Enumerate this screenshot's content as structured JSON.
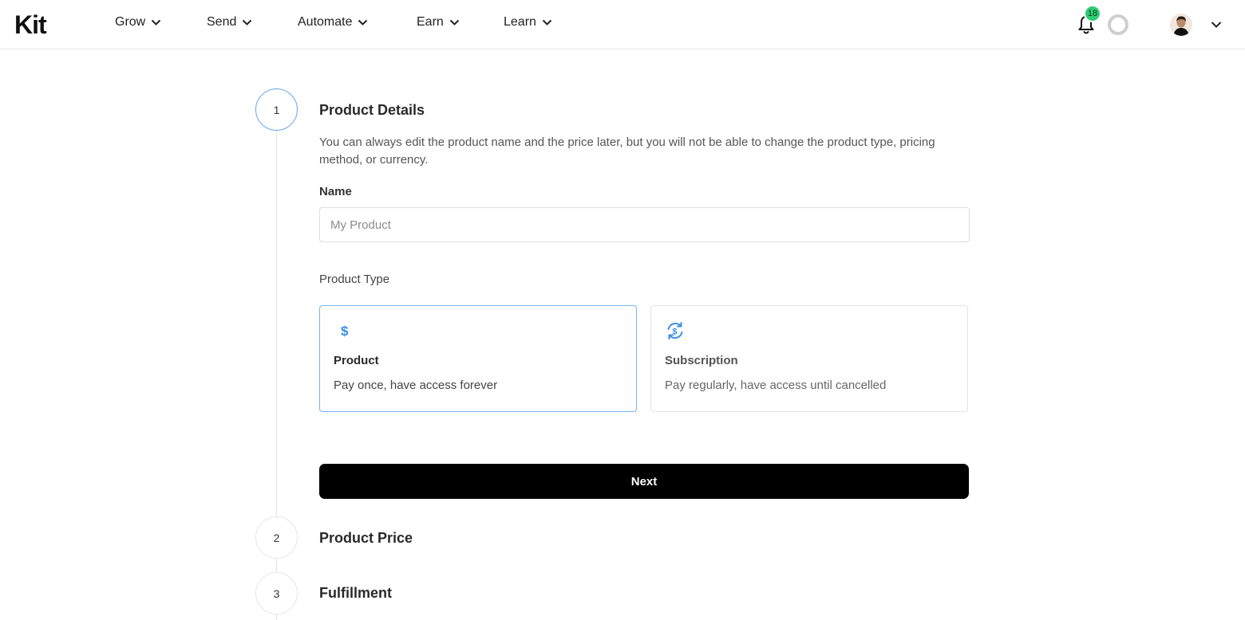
{
  "header": {
    "logo_text": "Kit",
    "nav": [
      {
        "label": "Grow"
      },
      {
        "label": "Send"
      },
      {
        "label": "Automate"
      },
      {
        "label": "Earn"
      },
      {
        "label": "Learn"
      }
    ],
    "notification_count": "18",
    "icons": [
      "bell-icon",
      "progress-ring-icon",
      "avatar",
      "chevron-down-icon"
    ]
  },
  "steps": [
    {
      "number": "1",
      "title": "Product Details"
    },
    {
      "number": "2",
      "title": "Product Price"
    },
    {
      "number": "3",
      "title": "Fulfillment"
    }
  ],
  "product_details": {
    "description": "You can always edit the product name and the price later, but you will not be able to change the product type, pricing method, or currency.",
    "name_label": "Name",
    "name_placeholder": "My Product",
    "name_value": "",
    "type_label": "Product Type",
    "types": [
      {
        "title": "Product",
        "description": "Pay once, have access forever",
        "icon": "dollar-icon",
        "selected": true
      },
      {
        "title": "Subscription",
        "description": "Pay regularly, have access until cancelled",
        "icon": "recurring-dollar-icon",
        "selected": false
      }
    ],
    "next_label": "Next"
  },
  "colors": {
    "accent": "#3b8ee6",
    "selected_border": "#7cb4ee",
    "badge": "#2ecc71",
    "button": "#000000"
  }
}
